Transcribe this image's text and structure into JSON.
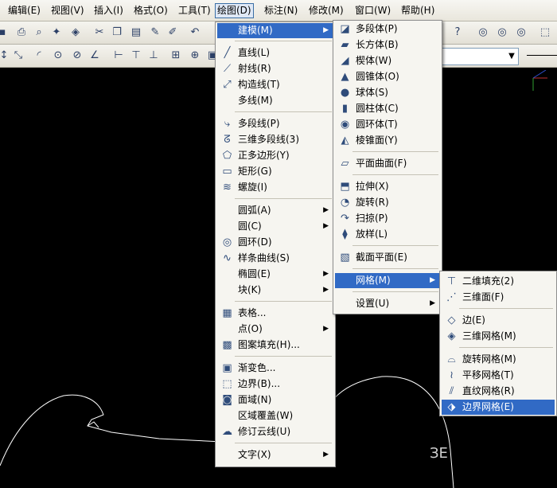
{
  "menubar": [
    "编辑(E)",
    "视图(V)",
    "插入(I)",
    "格式(O)",
    "工具(T)",
    "绘图(D)",
    "标注(N)",
    "修改(M)",
    "窗口(W)",
    "帮助(H)"
  ],
  "draw_menu": {
    "items": [
      {
        "label": "建模(M)",
        "icon": "",
        "submenu": true
      },
      {
        "label": "直线(L)",
        "icon": "line-icon"
      },
      {
        "label": "射线(R)",
        "icon": "ray-icon"
      },
      {
        "label": "构造线(T)",
        "icon": "xline-icon"
      },
      {
        "label": "多线(M)",
        "icon": ""
      },
      {
        "label": "多段线(P)",
        "icon": "polyline-icon"
      },
      {
        "label": "三维多段线(3)",
        "icon": "3dpoly-icon"
      },
      {
        "label": "正多边形(Y)",
        "icon": "polygon-icon"
      },
      {
        "label": "矩形(G)",
        "icon": "rectangle-icon"
      },
      {
        "label": "螺旋(I)",
        "icon": "helix-icon"
      },
      {
        "label": "圆弧(A)",
        "icon": "",
        "submenu": true
      },
      {
        "label": "圆(C)",
        "icon": "",
        "submenu": true
      },
      {
        "label": "圆环(D)",
        "icon": "donut-icon"
      },
      {
        "label": "样条曲线(S)",
        "icon": "spline-icon"
      },
      {
        "label": "椭圆(E)",
        "icon": "",
        "submenu": true
      },
      {
        "label": "块(K)",
        "icon": "",
        "submenu": true
      },
      {
        "label": "表格...",
        "icon": "table-icon"
      },
      {
        "label": "点(O)",
        "icon": "",
        "submenu": true
      },
      {
        "label": "图案填充(H)...",
        "icon": "hatch-icon"
      },
      {
        "label": "渐变色...",
        "icon": "gradient-icon"
      },
      {
        "label": "边界(B)...",
        "icon": "boundary-icon"
      },
      {
        "label": "面域(N)",
        "icon": "region-icon"
      },
      {
        "label": "区域覆盖(W)",
        "icon": ""
      },
      {
        "label": "修订云线(U)",
        "icon": "revcloud-icon"
      },
      {
        "label": "文字(X)",
        "icon": "",
        "submenu": true
      }
    ]
  },
  "modeling_menu": {
    "items": [
      {
        "label": "多段体(P)",
        "icon": "polysolid-icon"
      },
      {
        "label": "长方体(B)",
        "icon": "box-icon"
      },
      {
        "label": "楔体(W)",
        "icon": "wedge-icon"
      },
      {
        "label": "圆锥体(O)",
        "icon": "cone-icon"
      },
      {
        "label": "球体(S)",
        "icon": "sphere-icon"
      },
      {
        "label": "圆柱体(C)",
        "icon": "cylinder-icon"
      },
      {
        "label": "圆环体(T)",
        "icon": "torus-icon"
      },
      {
        "label": "棱锥面(Y)",
        "icon": "pyramid-icon"
      },
      {
        "label": "平面曲面(F)",
        "icon": "planesurf-icon"
      },
      {
        "label": "拉伸(X)",
        "icon": "extrude-icon"
      },
      {
        "label": "旋转(R)",
        "icon": "revolve-icon"
      },
      {
        "label": "扫掠(P)",
        "icon": "sweep-icon"
      },
      {
        "label": "放样(L)",
        "icon": "loft-icon"
      },
      {
        "label": "截面平面(E)",
        "icon": "sectionplane-icon"
      },
      {
        "label": "网格(M)",
        "icon": "",
        "submenu": true
      },
      {
        "label": "设置(U)",
        "icon": "",
        "submenu": true
      }
    ]
  },
  "mesh_menu": {
    "items": [
      {
        "label": "二维填充(2)",
        "icon": "2dsolid-icon"
      },
      {
        "label": "三维面(F)",
        "icon": "3dface-icon"
      },
      {
        "label": "边(E)",
        "icon": "edge-icon"
      },
      {
        "label": "三维网格(M)",
        "icon": "3dmesh-icon"
      },
      {
        "label": "旋转网格(M)",
        "icon": "revsurf-icon"
      },
      {
        "label": "平移网格(T)",
        "icon": "tabsurf-icon"
      },
      {
        "label": "直纹网格(R)",
        "icon": "rulesurf-icon"
      },
      {
        "label": "边界网格(E)",
        "icon": "edgesurf-icon"
      }
    ]
  },
  "colors": {
    "highlight": "#316ac5",
    "menu_bg": "#f6f5f0",
    "canvas_bg": "#000000"
  }
}
